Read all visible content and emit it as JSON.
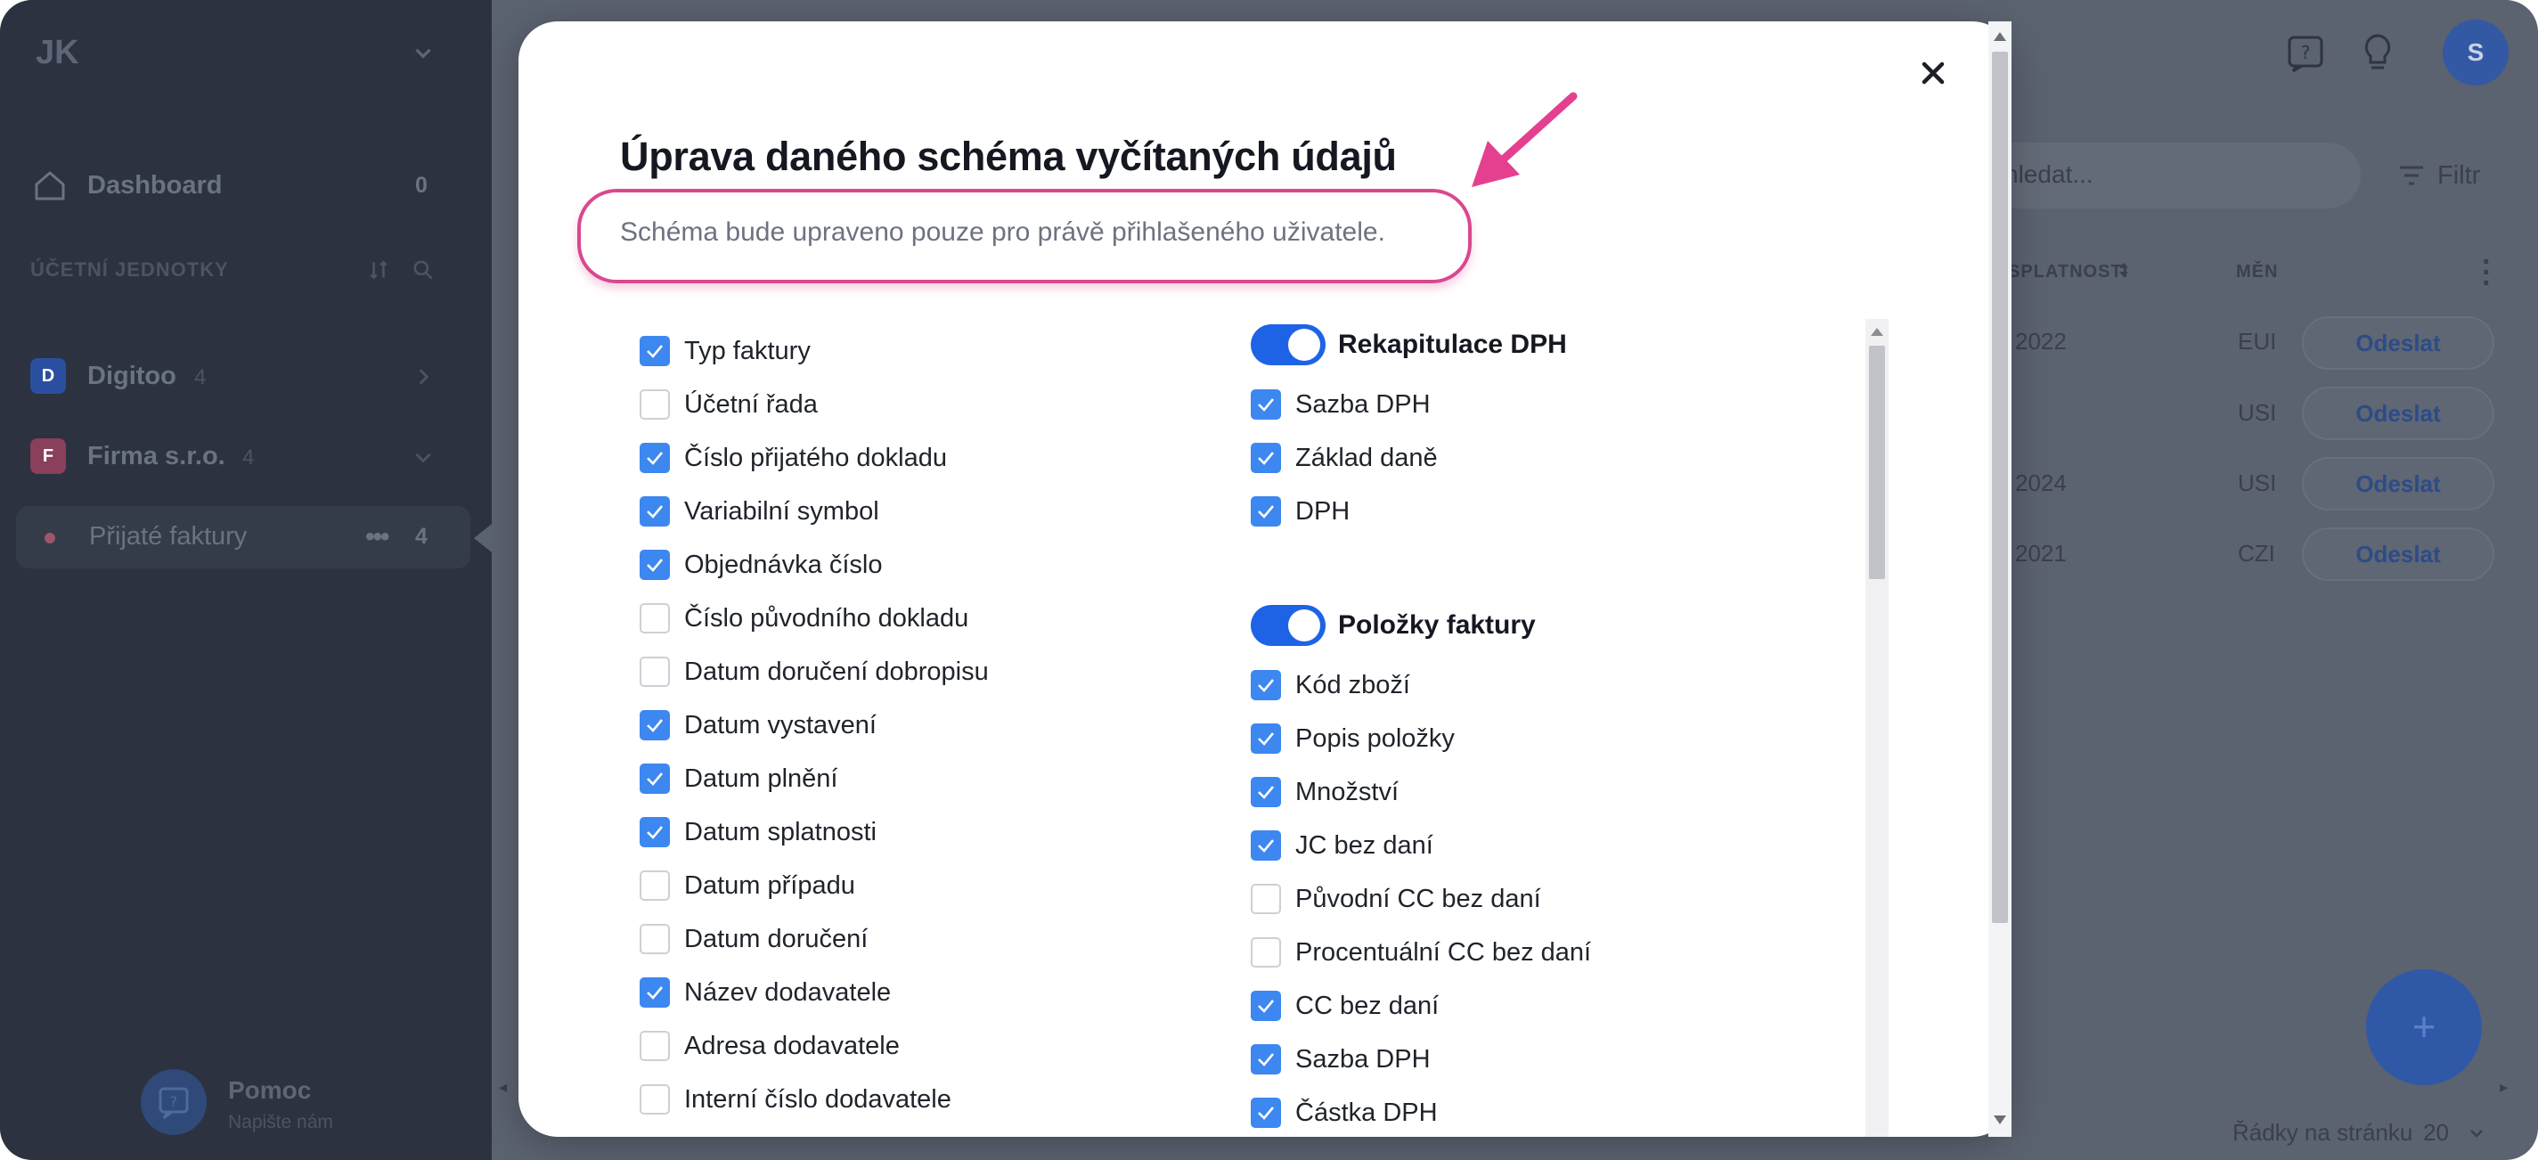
{
  "sidebar": {
    "brand": "JK",
    "dashboard": {
      "label": "Dashboard",
      "count": "0"
    },
    "section_title": "ÚČETNÍ JEDNOTKY",
    "units": [
      {
        "badge": "D",
        "name": "Digitoo",
        "count": "4",
        "color": "#2b4fa0"
      },
      {
        "badge": "F",
        "name": "Firma s.r.o.",
        "count": "4",
        "color": "#8a3f5a"
      }
    ],
    "active_item": {
      "name": "Přijaté faktury",
      "more": "•••",
      "count": "4"
    },
    "help": {
      "title": "Pomoc",
      "subtitle": "Napište nám"
    }
  },
  "background": {
    "avatar": "S",
    "search_placeholder": "hledat...",
    "filter_label": "Filtr",
    "columns": [
      "SPLATNOSTI",
      "MĚN"
    ],
    "rows": [
      {
        "date": "2022",
        "currency": "EUI",
        "action": "Odeslat"
      },
      {
        "date": "",
        "currency": "USI",
        "action": "Odeslat"
      },
      {
        "date": "2024",
        "currency": "USI",
        "action": "Odeslat"
      },
      {
        "date": "2021",
        "currency": "CZI",
        "action": "Odeslat"
      }
    ],
    "fab": "+",
    "rows_per_page_label": "Řádky na stránku",
    "rows_per_page_value": "20"
  },
  "modal": {
    "title": "Úprava daného schéma vyčítaných údajů",
    "note": "Schéma bude upraveno pouze pro právě přihlašeného uživatele.",
    "accent_color": "#d9488f",
    "left_fields": [
      {
        "label": "Typ faktury",
        "checked": true
      },
      {
        "label": "Účetní řada",
        "checked": false
      },
      {
        "label": "Číslo přijatého dokladu",
        "checked": true
      },
      {
        "label": "Variabilní symbol",
        "checked": true
      },
      {
        "label": "Objednávka číslo",
        "checked": true
      },
      {
        "label": "Číslo původního dokladu",
        "checked": false
      },
      {
        "label": "Datum doručení dobropisu",
        "checked": false
      },
      {
        "label": "Datum vystavení",
        "checked": true
      },
      {
        "label": "Datum plnění",
        "checked": true
      },
      {
        "label": "Datum splatnosti",
        "checked": true
      },
      {
        "label": "Datum případu",
        "checked": false
      },
      {
        "label": "Datum doručení",
        "checked": false
      },
      {
        "label": "Název dodavatele",
        "checked": true
      },
      {
        "label": "Adresa dodavatele",
        "checked": false
      },
      {
        "label": "Interní číslo dodavatele",
        "checked": false
      }
    ],
    "groups": [
      {
        "title": "Rekapitulace DPH",
        "enabled": true,
        "fields": [
          {
            "label": "Sazba DPH",
            "checked": true
          },
          {
            "label": "Základ daně",
            "checked": true
          },
          {
            "label": "DPH",
            "checked": true
          }
        ]
      },
      {
        "title": "Položky faktury",
        "enabled": true,
        "fields": [
          {
            "label": "Kód zboží",
            "checked": true
          },
          {
            "label": "Popis položky",
            "checked": true
          },
          {
            "label": "Množství",
            "checked": true
          },
          {
            "label": "JC bez daní",
            "checked": true
          },
          {
            "label": "Původní CC bez daní",
            "checked": false
          },
          {
            "label": "Procentuální CC bez daní",
            "checked": false
          },
          {
            "label": "CC bez daní",
            "checked": true
          },
          {
            "label": "Sazba DPH",
            "checked": true
          },
          {
            "label": "Částka DPH",
            "checked": true
          }
        ]
      }
    ]
  }
}
